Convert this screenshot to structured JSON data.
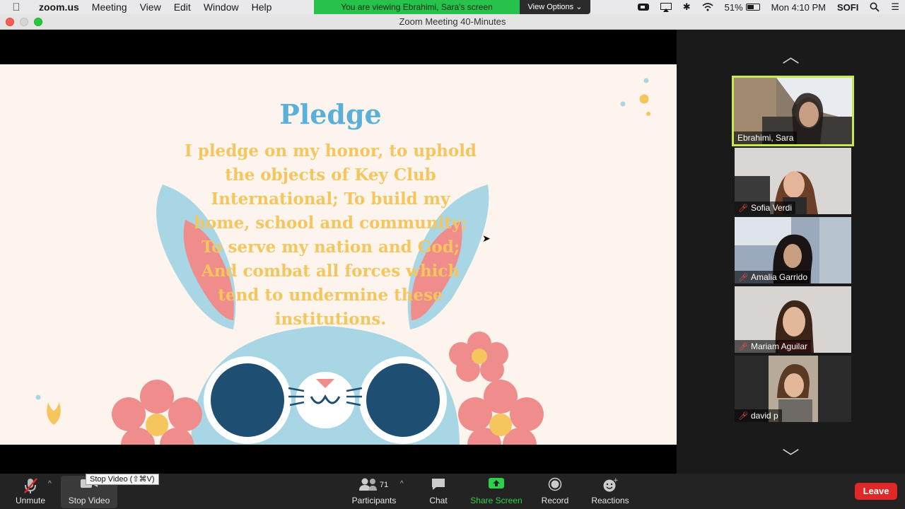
{
  "menubar": {
    "app": "zoom.us",
    "items": [
      "Meeting",
      "View",
      "Edit",
      "Window",
      "Help"
    ],
    "banner_text": "You are viewing Ebrahimi, Sara's screen",
    "view_options": "View Options",
    "battery": "51%",
    "clock": "Mon 4:10 PM",
    "user": "SOFI"
  },
  "window": {
    "title": "Zoom Meeting   40-Minutes"
  },
  "slide": {
    "title": "Pledge",
    "lines": [
      "I pledge on my honor, to uphold",
      "the objects of Key Club",
      "International; To build my",
      "home, school and community;",
      "To serve my nation and God;",
      "And combat all forces which",
      "tend to undermine these",
      "institutions."
    ]
  },
  "participants": [
    {
      "name": "Ebrahimi, Sara",
      "muted": false,
      "active": true
    },
    {
      "name": "Sofia Verdi",
      "muted": true,
      "active": false
    },
    {
      "name": "Amalia Garrido",
      "muted": true,
      "active": false
    },
    {
      "name": "Mariam Aguilar",
      "muted": true,
      "active": false
    },
    {
      "name": "david p",
      "muted": true,
      "active": false
    }
  ],
  "toolbar": {
    "unmute": "Unmute",
    "stop_video": "Stop Video",
    "tooltip": "Stop Video (⇧⌘V)",
    "participants": "Participants",
    "participants_count": "71",
    "chat": "Chat",
    "share_screen": "Share Screen",
    "record": "Record",
    "reactions": "Reactions",
    "leave": "Leave"
  },
  "colors": {
    "share_green": "#2dd04a",
    "active_border": "#c6e94b",
    "leave_red": "#e02828",
    "slide_title": "#5ab0d8",
    "slide_text": "#f6c65e"
  }
}
